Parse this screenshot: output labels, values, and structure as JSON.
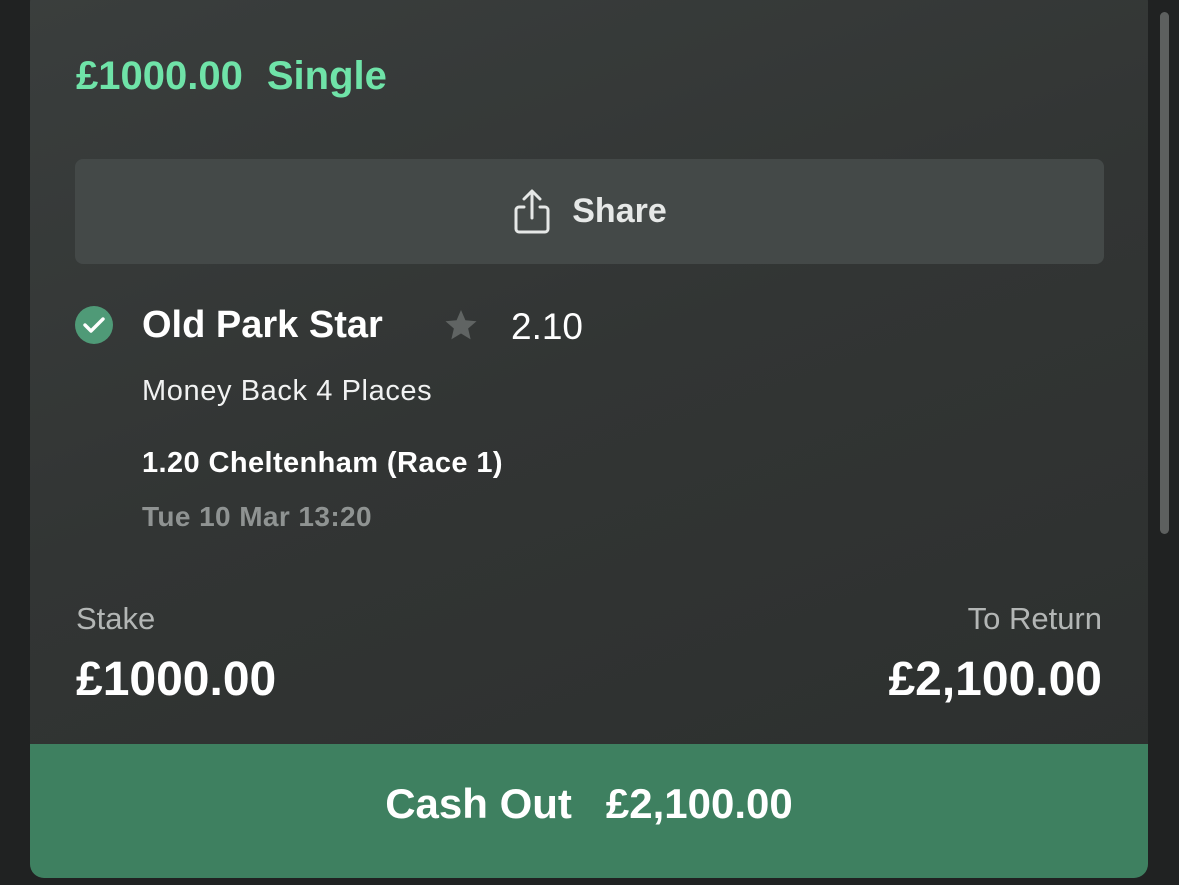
{
  "bet": {
    "amount": "£1000.00",
    "type": "Single"
  },
  "share": {
    "label": "Share",
    "icon": "share-icon"
  },
  "selection": {
    "status_icon": "check-circle-icon",
    "name": "Old Park Star",
    "favourite_icon": "star-icon",
    "odds": "2.10",
    "market": "Money Back 4 Places",
    "event": "1.20 Cheltenham (Race 1)",
    "datetime": "Tue 10 Mar 13:20"
  },
  "summary": {
    "stake_label": "Stake",
    "stake_value": "£1000.00",
    "return_label": "To Return",
    "return_value": "£2,100.00"
  },
  "cashout": {
    "label": "Cash Out",
    "value": "£2,100.00"
  },
  "colors": {
    "accent_green": "#6fe3a8",
    "cashout_bg": "#3e8060",
    "check_green": "#4f9a77",
    "card_bg": "#333635"
  }
}
